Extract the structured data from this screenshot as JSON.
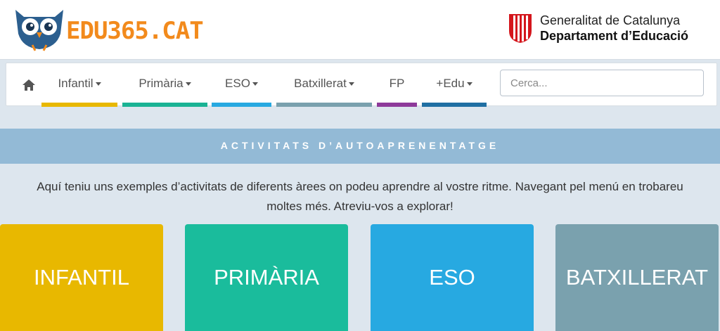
{
  "header": {
    "logo_text": "EDU365.CAT",
    "gen_line1": "Generalitat de Catalunya",
    "gen_line2": "Departament d’Educació"
  },
  "nav": {
    "home_icon": "home-icon",
    "items": [
      {
        "label": "Infantil",
        "dropdown": true,
        "color": "#e8b800"
      },
      {
        "label": "Primària",
        "dropdown": true,
        "color": "#1ab394"
      },
      {
        "label": "ESO",
        "dropdown": true,
        "color": "#27a9e1"
      },
      {
        "label": "Batxillerat",
        "dropdown": true,
        "color": "#7aa1ae"
      },
      {
        "label": "FP",
        "dropdown": false,
        "color": "#8e3a9a"
      },
      {
        "label": "+Edu",
        "dropdown": true,
        "color": "#1f6fa3"
      }
    ],
    "search_placeholder": "Cerca..."
  },
  "banner": {
    "title": "ACTIVITATS D’AUTOAPRENENTATGE",
    "color": "#93bad6"
  },
  "intro": {
    "line1": "Aquí teniu uns exemples d’activitats de diferents àrees on podeu aprendre al vostre ritme. Navegant pel menú en trobareu",
    "line2": "moltes més. Atreviu-vos a explorar!"
  },
  "cards": [
    {
      "label": "INFANTIL",
      "color": "#e8b800"
    },
    {
      "label": "PRIMÀRIA",
      "color": "#1abc9c"
    },
    {
      "label": "ESO",
      "color": "#27a9e1"
    },
    {
      "label": "BATXILLERAT",
      "color": "#7aa1ae"
    }
  ]
}
